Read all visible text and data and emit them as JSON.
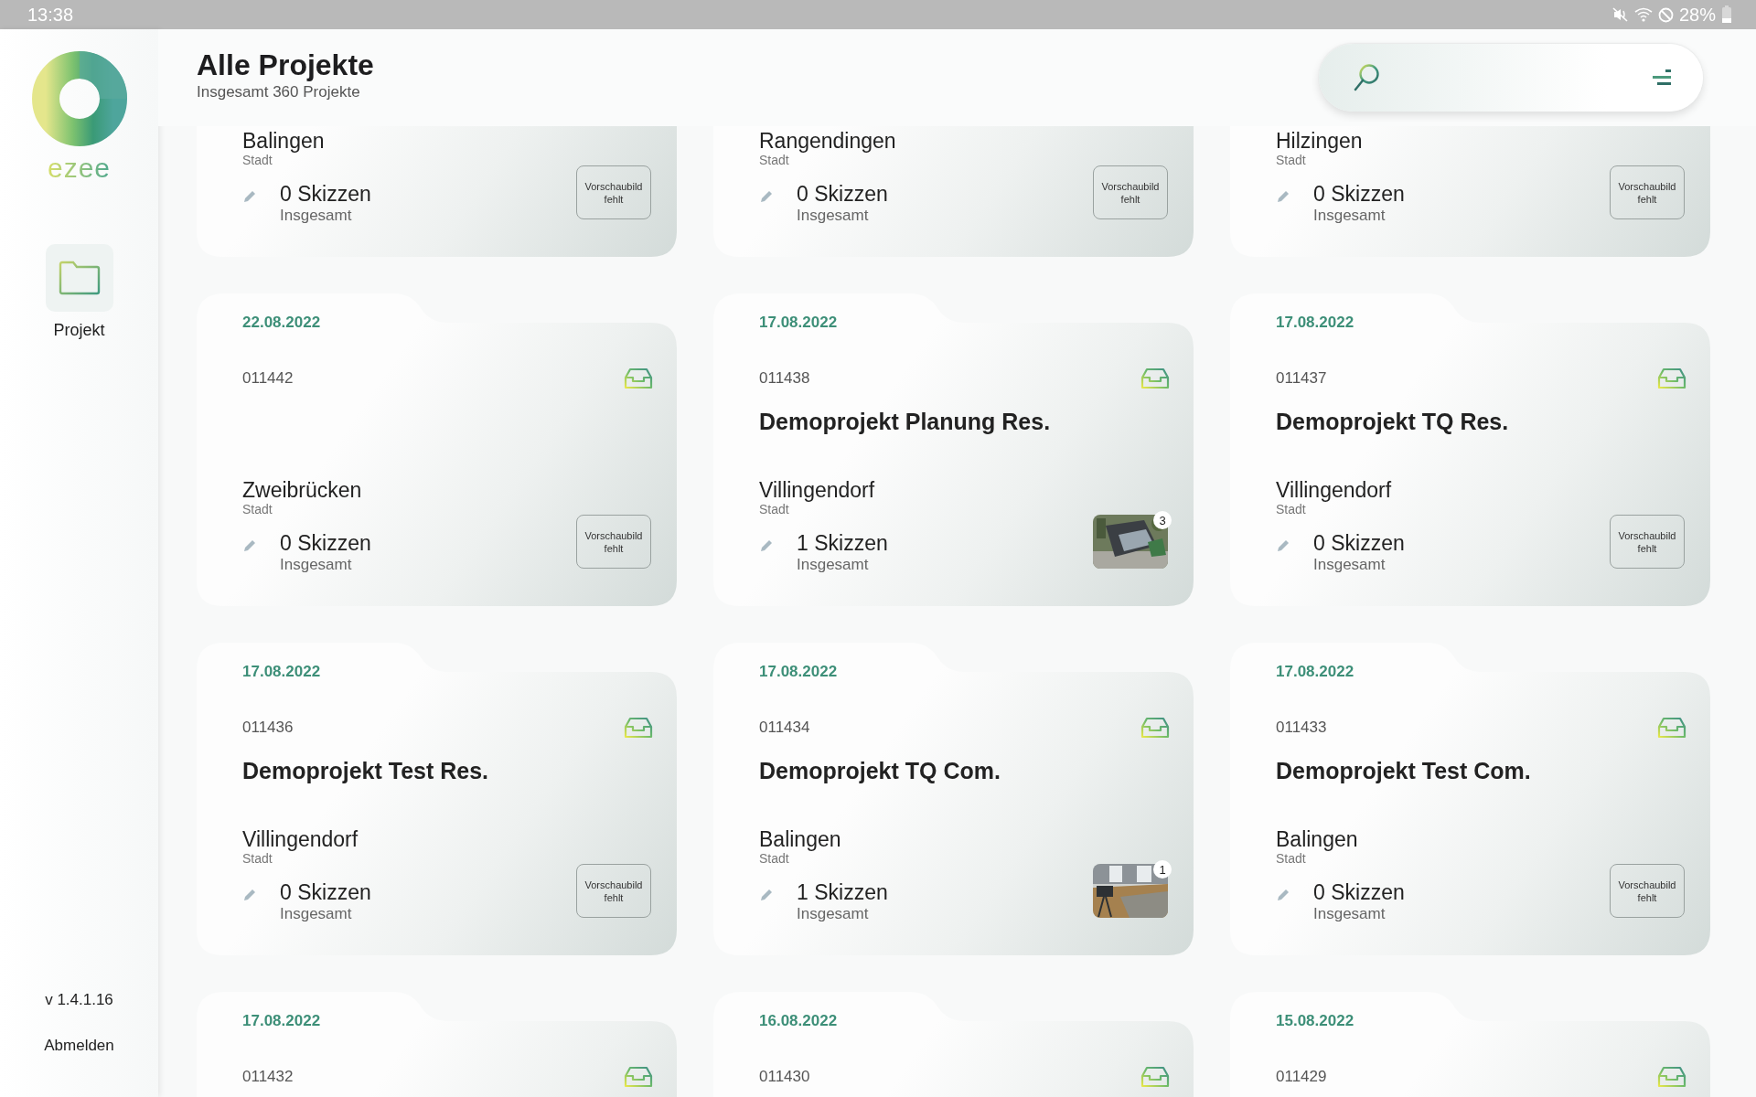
{
  "status_bar": {
    "time": "13:38",
    "battery": "28%"
  },
  "sidebar": {
    "logo_text": "ezee",
    "items": [
      {
        "label": "Projekt",
        "selected": true
      }
    ],
    "version": "v 1.4.1.16",
    "logout": "Abmelden"
  },
  "header": {
    "title": "Alle Projekte",
    "subtitle": "Insgesamt 360 Projekte"
  },
  "projects": [
    {
      "city": "Balingen",
      "city_label": "Stadt",
      "sketches": "0 Skizzen",
      "sketches_label": "Insgesamt",
      "preview": {
        "kind": "missing",
        "label": "Vorschaubild fehlt"
      }
    },
    {
      "city": "Rangendingen",
      "city_label": "Stadt",
      "sketches": "0 Skizzen",
      "sketches_label": "Insgesamt",
      "preview": {
        "kind": "missing",
        "label": "Vorschaubild fehlt"
      }
    },
    {
      "city": "Hilzingen",
      "city_label": "Stadt",
      "sketches": "0 Skizzen",
      "sketches_label": "Insgesamt",
      "preview": {
        "kind": "missing",
        "label": "Vorschaubild fehlt"
      }
    },
    {
      "date": "22.08.2022",
      "number": "011442",
      "city": "Zweibrücken",
      "city_label": "Stadt",
      "sketches": "0 Skizzen",
      "sketches_label": "Insgesamt",
      "preview": {
        "kind": "missing",
        "label": "Vorschaubild fehlt"
      }
    },
    {
      "date": "17.08.2022",
      "number": "011438",
      "name": "Demoprojekt Planung Res.",
      "city": "Villingendorf",
      "city_label": "Stadt",
      "sketches": "1 Skizzen",
      "sketches_label": "Insgesamt",
      "preview": {
        "kind": "picture",
        "count": "3"
      }
    },
    {
      "date": "17.08.2022",
      "number": "011437",
      "name": "Demoprojekt TQ Res.",
      "city": "Villingendorf",
      "city_label": "Stadt",
      "sketches": "0 Skizzen",
      "sketches_label": "Insgesamt",
      "preview": {
        "kind": "missing",
        "label": "Vorschaubild fehlt"
      }
    },
    {
      "date": "17.08.2022",
      "number": "011436",
      "name": "Demoprojekt Test Res.",
      "city": "Villingendorf",
      "city_label": "Stadt",
      "sketches": "0 Skizzen",
      "sketches_label": "Insgesamt",
      "preview": {
        "kind": "missing",
        "label": "Vorschaubild fehlt"
      }
    },
    {
      "date": "17.08.2022",
      "number": "011434",
      "name": "Demoprojekt TQ Com.",
      "city": "Balingen",
      "city_label": "Stadt",
      "sketches": "1 Skizzen",
      "sketches_label": "Insgesamt",
      "preview": {
        "kind": "picture",
        "count": "1"
      }
    },
    {
      "date": "17.08.2022",
      "number": "011433",
      "name": "Demoprojekt Test Com.",
      "city": "Balingen",
      "city_label": "Stadt",
      "sketches": "0 Skizzen",
      "sketches_label": "Insgesamt",
      "preview": {
        "kind": "missing",
        "label": "Vorschaubild fehlt"
      }
    },
    {
      "date": "17.08.2022",
      "number": "011432"
    },
    {
      "date": "16.08.2022",
      "number": "011430"
    },
    {
      "date": "15.08.2022",
      "number": "011429"
    }
  ]
}
